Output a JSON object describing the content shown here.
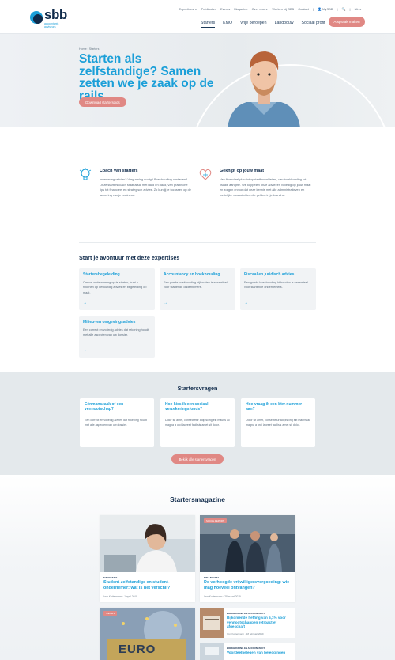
{
  "header": {
    "logo_text": "sbb",
    "logo_sub": "accountants adviseurs",
    "top_links": [
      "Expertises ⌄",
      "Publicaties",
      "Events",
      "Magazine",
      "Over ons ⌄",
      "Werken bij SBB",
      "Contact",
      "|",
      "👤 MySBB",
      "|",
      "🔍",
      "|",
      "NL ⌄"
    ],
    "main_nav": [
      "Starters",
      "KMO",
      "Vrije beroepen",
      "Landbouw",
      "Sociaal profit"
    ],
    "cta": "Afspraak maken"
  },
  "hero": {
    "breadcrumb": "Home  ›  Starters",
    "title": "Starten als zelfstandige? Samen zetten we je zaak op de rails",
    "button": "Download startersgids"
  },
  "features": [
    {
      "icon": "lightbulb-icon",
      "title": "Coach van starters",
      "text": "Investeringsadvies? Vergunning nodig? Boekhouding opstarten? Onze starterscoach staat arsal met raad en daad, van praktische tips tot financieel en strategisch advies. Zo kun jij je focussen op de lancering van je business."
    },
    {
      "icon": "heart-tool-icon",
      "title": "Geknipt op jouw maat",
      "text": "Van financieel plan tot opstartformaliteiten, van boekhouding tot fiscale aangifte. We koppelen onze adviezen volledig op jouw maat en zorgen ervoor dat deze kennis met alle administratieven en wettelijke voorschriften die gelden in je branche."
    }
  ],
  "expertises": {
    "title": "Start je avontuur met deze expertises",
    "cards": [
      {
        "title": "Startersbegeleiding",
        "text": "Om uw onderneming op te starten, kunt u rekenen op deskundig advies en begeleiding op maat."
      },
      {
        "title": "Accountancy en boekhouding",
        "text": "Een goede boekhouding bijhouden is essentieel voor startende ondernemers."
      },
      {
        "title": "Fiscaal en juridisch advies",
        "text": "Een goede boekhouding bijhouden is essentieel voor startende ondernemers."
      },
      {
        "title": "Milieu- en omgevingsadvies",
        "text": "Een correct en volledig advies dat rekening houdt met alle aspecten van uw dossier."
      }
    ],
    "arrow": "→"
  },
  "questions": {
    "title": "Startersvragen",
    "cards": [
      {
        "title": "Eénmanszaak of een vennootschap?",
        "text": "Een correct en volledig advies dat rekening houdt met alle aspecten van uw dossier."
      },
      {
        "title": "Hoe kies ik een sociaal verzekeringsfonds?",
        "text": "Dolor sit amet, consectetur adipiscing elit mauris ac magna a orci laoreet facilisis amet sit dolor."
      },
      {
        "title": "Hoe vraag ik een btw-nummer aan?",
        "text": "Dolor sit amet, consectetur adipiscing elit mauris ac magna a orci laoreet facilisis amet sit dolor."
      }
    ],
    "button": "Bekijk alle startersvragen"
  },
  "magazine": {
    "title": "Startersmagazine",
    "big": [
      {
        "category": "STARTERS",
        "title": "Student-zelfstandige en student-ondernemer: wat is het verschil?",
        "author": "Ivon Kottermann",
        "date": "1 april 2019"
      },
      {
        "tag": "SOCIAL REPORT",
        "category": "FINANCIEEL",
        "title": "De verhoogde vrijwilligersvergoeding: wie mag hoeveel ontvangen?",
        "author": "Ivon Kottermann",
        "date": "28 maart 2019"
      }
    ],
    "bottom": {
      "tag": "NIEUWS",
      "euro_text": "EURO"
    },
    "small": [
      {
        "category": "BOEKHOUDING EN ACCOUNTANCY",
        "title": "Bijkomende heffing van 5,1% voor vennootschappen retroactief afgeschaft",
        "author": "Ivon Kottermann",
        "date": "18 februari 2019"
      },
      {
        "category": "BOEKHOUDING EN ACCOUNTANCY",
        "title": "Voordeelbelegen van beleggingen",
        "author": "",
        "date": ""
      }
    ]
  }
}
